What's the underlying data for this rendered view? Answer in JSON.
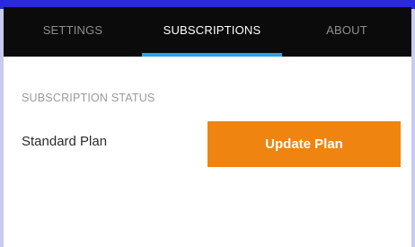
{
  "tabs": [
    {
      "label": "SETTINGS",
      "active": false
    },
    {
      "label": "SUBSCRIPTIONS",
      "active": true
    },
    {
      "label": "ABOUT",
      "active": false
    }
  ],
  "accent_colors": {
    "tab_underline": "#2aa2ea",
    "button": "#ef8510",
    "tabbar_bg": "#0b0b0b"
  },
  "subscription": {
    "section_label": "SUBSCRIPTION STATUS",
    "plan_name": "Standard Plan",
    "update_button_label": "Update Plan"
  }
}
